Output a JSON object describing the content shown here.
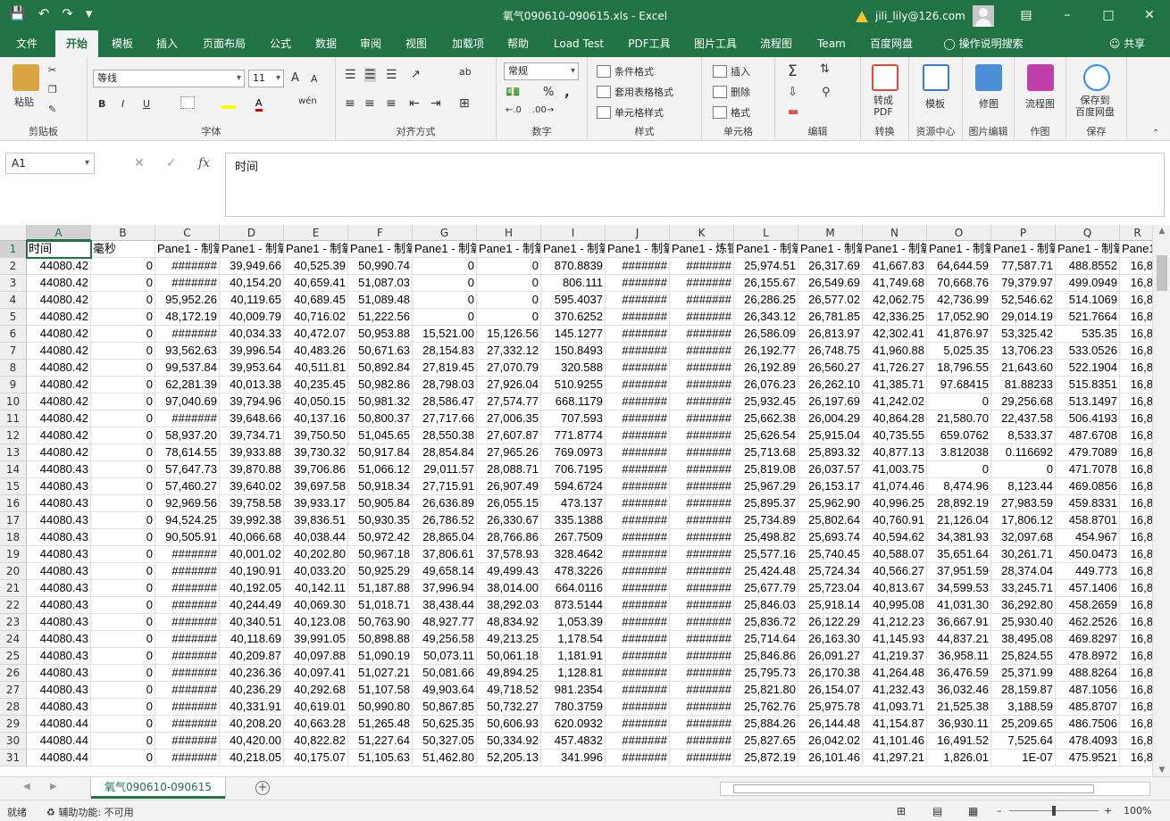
{
  "titlebar": {
    "doc_title": "氧气090610-090615.xls  -  Excel",
    "account": "jili_lily@126.com",
    "warning_icon": "warning-icon",
    "save_icon": "save-icon"
  },
  "tabs": [
    "文件",
    "开始",
    "模板",
    "插入",
    "页面布局",
    "公式",
    "数据",
    "审阅",
    "视图",
    "加载项",
    "帮助",
    "Load Test",
    "PDF工具",
    "图片工具",
    "流程图",
    "Team",
    "百度网盘"
  ],
  "active_tab": "开始",
  "tell_me": "操作说明搜索",
  "share": "共享",
  "ribbon": {
    "clipboard": {
      "paste": "粘贴",
      "label": "剪贴板"
    },
    "font": {
      "name": "等线",
      "size": "11",
      "grow": "A",
      "shrink": "A",
      "bold": "B",
      "italic": "I",
      "underline": "U",
      "font_color": "A",
      "pinyin": "wén",
      "label": "字体"
    },
    "align": {
      "wrap": "ab",
      "label": "对齐方式"
    },
    "number": {
      "format": "常规",
      "percent": "%",
      "comma": ",",
      "label": "数字"
    },
    "styles": {
      "conditional": "条件格式",
      "table": "套用表格格式",
      "cell": "单元格样式",
      "label": "样式"
    },
    "cells": {
      "insert": "插入",
      "delete": "删除",
      "format": "格式",
      "label": "单元格"
    },
    "edit": {
      "label": "编辑"
    },
    "convert": {
      "btn": "转成\nPDF",
      "label": "转换"
    },
    "resource": {
      "btn": "模板",
      "label": "资源中心"
    },
    "image": {
      "btn": "修图",
      "label": "图片编辑"
    },
    "draw": {
      "btn": "流程图",
      "label": "作图"
    },
    "save": {
      "btn": "保存到\n百度网盘",
      "label": "保存"
    }
  },
  "formula_bar": {
    "name_box": "A1",
    "fx": "fx",
    "value": "时间"
  },
  "columns": [
    "A",
    "B",
    "C",
    "D",
    "E",
    "F",
    "G",
    "H",
    "I",
    "J",
    "K",
    "L",
    "M",
    "N",
    "O",
    "P",
    "Q",
    "R"
  ],
  "header_row": [
    "时间",
    "毫秒",
    "Pane1 - 制氧",
    "Pane1 - 制氧",
    "Pane1 - 制氧",
    "Pane1 - 制氧",
    "Pane1 - 制氧",
    "Pane1 - 制氧",
    "Pane1 - 制氧",
    "Pane1 - 制氧",
    "Pane1 - 炼钢",
    "Pane1 - 制氧",
    "Pane1 - 制氧",
    "Pane1 - 制氧",
    "Pane1 - 制氧",
    "Pane1 - 制氧",
    "Pane1 - 制氧",
    "Pane1"
  ],
  "rows": [
    [
      "44080.42",
      "0",
      "#######",
      "39,949.66",
      "40,525.39",
      "50,990.74",
      "0",
      "0",
      "870.8839",
      "#######",
      "#######",
      "25,974.51",
      "26,317.69",
      "41,667.83",
      "64,644.59",
      "77,587.71",
      "488.8552",
      "16,8"
    ],
    [
      "44080.42",
      "0",
      "#######",
      "40,154.20",
      "40,659.41",
      "51,087.03",
      "0",
      "0",
      "806.111",
      "#######",
      "#######",
      "26,155.67",
      "26,549.69",
      "41,749.68",
      "70,668.76",
      "79,379.97",
      "499.0949",
      "16,8"
    ],
    [
      "44080.42",
      "0",
      "95,952.26",
      "40,119.65",
      "40,689.45",
      "51,089.48",
      "0",
      "0",
      "595.4037",
      "#######",
      "#######",
      "26,286.25",
      "26,577.02",
      "42,062.75",
      "42,736.99",
      "52,546.62",
      "514.1069",
      "16,8"
    ],
    [
      "44080.42",
      "0",
      "48,172.19",
      "40,009.79",
      "40,716.02",
      "51,222.56",
      "0",
      "0",
      "370.6252",
      "#######",
      "#######",
      "26,343.12",
      "26,781.85",
      "42,336.25",
      "17,052.90",
      "29,014.19",
      "521.7664",
      "16,8"
    ],
    [
      "44080.42",
      "0",
      "#######",
      "40,034.33",
      "40,472.07",
      "50,953.88",
      "15,521.00",
      "15,126.56",
      "145.1277",
      "#######",
      "#######",
      "26,586.09",
      "26,813.97",
      "42,302.41",
      "41,876.97",
      "53,325.42",
      "535.35",
      "16,8"
    ],
    [
      "44080.42",
      "0",
      "93,562.63",
      "39,996.54",
      "40,483.26",
      "50,671.63",
      "28,154.83",
      "27,332.12",
      "150.8493",
      "#######",
      "#######",
      "26,192.77",
      "26,748.75",
      "41,960.88",
      "5,025.35",
      "13,706.23",
      "533.0526",
      "16,8"
    ],
    [
      "44080.42",
      "0",
      "99,537.84",
      "39,953.64",
      "40,511.81",
      "50,892.84",
      "27,819.45",
      "27,070.79",
      "320.588",
      "#######",
      "#######",
      "26,192.89",
      "26,560.27",
      "41,726.27",
      "18,796.55",
      "21,643.60",
      "522.1904",
      "16,8"
    ],
    [
      "44080.42",
      "0",
      "62,281.39",
      "40,013.38",
      "40,235.45",
      "50,982.86",
      "28,798.03",
      "27,926.04",
      "510.9255",
      "#######",
      "#######",
      "26,076.23",
      "26,262.10",
      "41,385.71",
      "97.68415",
      "81.88233",
      "515.8351",
      "16,8"
    ],
    [
      "44080.42",
      "0",
      "97,040.69",
      "39,794.96",
      "40,050.15",
      "50,981.32",
      "28,586.47",
      "27,574.77",
      "668.1179",
      "#######",
      "#######",
      "25,932.45",
      "26,197.69",
      "41,242.02",
      "0",
      "29,256.68",
      "513.1497",
      "16,8"
    ],
    [
      "44080.42",
      "0",
      "#######",
      "39,648.66",
      "40,137.16",
      "50,800.37",
      "27,717.66",
      "27,006.35",
      "707.593",
      "#######",
      "#######",
      "25,662.38",
      "26,004.29",
      "40,864.28",
      "21,580.70",
      "22,437.58",
      "506.4193",
      "16,8"
    ],
    [
      "44080.42",
      "0",
      "58,937.20",
      "39,734.71",
      "39,750.50",
      "51,045.65",
      "28,550.38",
      "27,607.87",
      "771.8774",
      "#######",
      "#######",
      "25,626.54",
      "25,915.04",
      "40,735.55",
      "659.0762",
      "8,533.37",
      "487.6708",
      "16,8"
    ],
    [
      "44080.42",
      "0",
      "78,614.55",
      "39,933.88",
      "39,730.32",
      "50,917.84",
      "28,854.84",
      "27,965.26",
      "769.0973",
      "#######",
      "#######",
      "25,713.68",
      "25,893.32",
      "40,877.13",
      "3.812038",
      "0.116692",
      "479.7089",
      "16,8"
    ],
    [
      "44080.43",
      "0",
      "57,647.73",
      "39,870.88",
      "39,706.86",
      "51,066.12",
      "29,011.57",
      "28,088.71",
      "706.7195",
      "#######",
      "#######",
      "25,819.08",
      "26,037.57",
      "41,003.75",
      "0",
      "0",
      "471.7078",
      "16,8"
    ],
    [
      "44080.43",
      "0",
      "57,460.27",
      "39,640.02",
      "39,697.58",
      "50,918.34",
      "27,715.91",
      "26,907.49",
      "594.6724",
      "#######",
      "#######",
      "25,967.29",
      "26,153.17",
      "41,074.46",
      "8,474.96",
      "8,123.44",
      "469.0856",
      "16,8"
    ],
    [
      "44080.43",
      "0",
      "92,969.56",
      "39,758.58",
      "39,933.17",
      "50,905.84",
      "26,636.89",
      "26,055.15",
      "473.137",
      "#######",
      "#######",
      "25,895.37",
      "25,962.90",
      "40,996.25",
      "28,892.19",
      "27,983.59",
      "459.8331",
      "16,8"
    ],
    [
      "44080.43",
      "0",
      "94,524.25",
      "39,992.38",
      "39,836.51",
      "50,930.35",
      "26,786.52",
      "26,330.67",
      "335.1388",
      "#######",
      "#######",
      "25,734.89",
      "25,802.64",
      "40,760.91",
      "21,126.04",
      "17,806.12",
      "458.8701",
      "16,8"
    ],
    [
      "44080.43",
      "0",
      "90,505.91",
      "40,066.68",
      "40,038.44",
      "50,972.42",
      "28,865.04",
      "28,766.86",
      "267.7509",
      "#######",
      "#######",
      "25,498.82",
      "25,693.74",
      "40,594.62",
      "34,381.93",
      "32,097.68",
      "454.967",
      "16,8"
    ],
    [
      "44080.43",
      "0",
      "#######",
      "40,001.02",
      "40,202.80",
      "50,967.18",
      "37,806.61",
      "37,578.93",
      "328.4642",
      "#######",
      "#######",
      "25,577.16",
      "25,740.45",
      "40,588.07",
      "35,651.64",
      "30,261.71",
      "450.0473",
      "16,8"
    ],
    [
      "44080.43",
      "0",
      "#######",
      "40,190.91",
      "40,033.20",
      "50,925.29",
      "49,658.14",
      "49,499.43",
      "478.3226",
      "#######",
      "#######",
      "25,424.48",
      "25,724.34",
      "40,566.27",
      "37,951.59",
      "28,374.04",
      "449.773",
      "16,8"
    ],
    [
      "44080.43",
      "0",
      "#######",
      "40,192.05",
      "40,142.11",
      "51,187.88",
      "37,996.94",
      "38,014.00",
      "664.0116",
      "#######",
      "#######",
      "25,677.79",
      "25,723.04",
      "40,813.67",
      "34,599.53",
      "33,245.71",
      "457.1406",
      "16,8"
    ],
    [
      "44080.43",
      "0",
      "#######",
      "40,244.49",
      "40,069.30",
      "51,018.71",
      "38,438.44",
      "38,292.03",
      "873.5144",
      "#######",
      "#######",
      "25,846.03",
      "25,918.14",
      "40,995.08",
      "41,031.30",
      "36,292.80",
      "458.2659",
      "16,8"
    ],
    [
      "44080.43",
      "0",
      "#######",
      "40,340.51",
      "40,123.08",
      "50,763.90",
      "48,927.77",
      "48,834.92",
      "1,053.39",
      "#######",
      "#######",
      "25,836.72",
      "26,122.29",
      "41,212.23",
      "36,667.91",
      "25,930.40",
      "462.2526",
      "16,8"
    ],
    [
      "44080.43",
      "0",
      "#######",
      "40,118.69",
      "39,991.05",
      "50,898.88",
      "49,256.58",
      "49,213.25",
      "1,178.54",
      "#######",
      "#######",
      "25,714.64",
      "26,163.30",
      "41,145.93",
      "44,837.21",
      "38,495.08",
      "469.8297",
      "16,8"
    ],
    [
      "44080.43",
      "0",
      "#######",
      "40,209.87",
      "40,097.88",
      "51,090.19",
      "50,073.11",
      "50,061.18",
      "1,181.91",
      "#######",
      "#######",
      "25,846.86",
      "26,091.27",
      "41,219.37",
      "36,958.11",
      "25,824.55",
      "478.8972",
      "16,8"
    ],
    [
      "44080.43",
      "0",
      "#######",
      "40,236.36",
      "40,097.41",
      "51,027.21",
      "50,081.66",
      "49,894.25",
      "1,128.81",
      "#######",
      "#######",
      "25,795.73",
      "26,170.38",
      "41,264.48",
      "36,476.59",
      "25,371.99",
      "488.8264",
      "16,8"
    ],
    [
      "44080.43",
      "0",
      "#######",
      "40,236.29",
      "40,292.68",
      "51,107.58",
      "49,903.64",
      "49,718.52",
      "981.2354",
      "#######",
      "#######",
      "25,821.80",
      "26,154.07",
      "41,232.43",
      "36,032.46",
      "28,159.87",
      "487.1056",
      "16,8"
    ],
    [
      "44080.43",
      "0",
      "#######",
      "40,331.91",
      "40,619.01",
      "50,990.80",
      "50,867.85",
      "50,732.27",
      "780.3759",
      "#######",
      "#######",
      "25,762.76",
      "25,975.78",
      "41,093.71",
      "21,525.38",
      "3,188.59",
      "485.8707",
      "16,8"
    ],
    [
      "44080.44",
      "0",
      "#######",
      "40,208.20",
      "40,663.28",
      "51,265.48",
      "50,625.35",
      "50,606.93",
      "620.0932",
      "#######",
      "#######",
      "25,884.26",
      "26,144.48",
      "41,154.87",
      "36,930.11",
      "25,209.65",
      "486.7506",
      "16,8"
    ],
    [
      "44080.44",
      "0",
      "#######",
      "40,420.00",
      "40,822.82",
      "51,227.64",
      "50,327.05",
      "50,334.92",
      "457.4832",
      "#######",
      "#######",
      "25,827.65",
      "26,042.02",
      "41,101.46",
      "16,491.52",
      "7,525.64",
      "478.4093",
      "16,8"
    ],
    [
      "44080.44",
      "0",
      "#######",
      "40,218.05",
      "40,175.07",
      "51,105.63",
      "51,462.80",
      "52,205.13",
      "341.996",
      "#######",
      "#######",
      "25,872.19",
      "26,101.46",
      "41,297.21",
      "1,826.01",
      "1E-07",
      "475.9521",
      "16,8"
    ]
  ],
  "sheet_tab": "氧气090610-090615",
  "status": {
    "ready": "就绪",
    "accessibility": "辅助功能: 不可用",
    "zoom": "100%"
  }
}
